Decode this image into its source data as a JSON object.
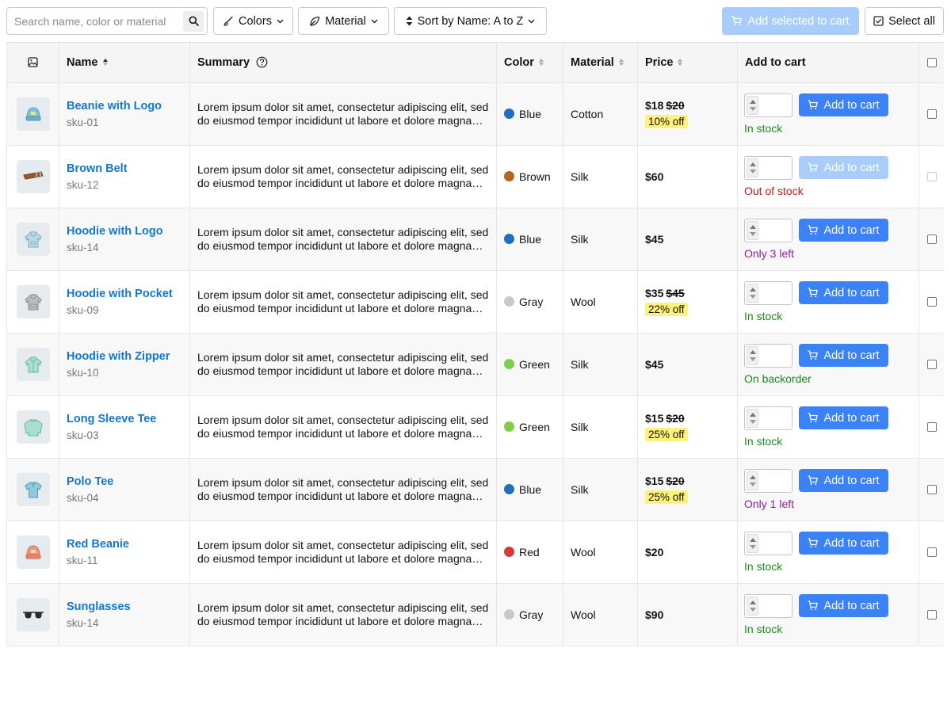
{
  "toolbar": {
    "search_placeholder": "Search name, color or material",
    "colors_label": "Colors",
    "material_label": "Material",
    "sort_label": "Sort by Name: A to Z",
    "add_selected_label": "Add selected to cart",
    "select_all_label": "Select all"
  },
  "table": {
    "headers": {
      "name": "Name",
      "summary": "Summary",
      "color": "Color",
      "material": "Material",
      "price": "Price",
      "add_to_cart": "Add to cart"
    },
    "cart_button_label": "Add to cart",
    "rows": [
      {
        "name": "Beanie with Logo",
        "sku": "sku-01",
        "summary": "Lorem ipsum dolor sit amet, consectetur adipiscing elit, sed do eiusmod tempor incididunt ut labore et dolore magna aliqua.",
        "color": "Blue",
        "color_hex": "#1f6fc1",
        "material": "Cotton",
        "price": "$18",
        "old_price": "$20",
        "discount": "10% off",
        "stock": "In stock",
        "stock_type": "in",
        "disabled": false,
        "icon": "beanie-icon"
      },
      {
        "name": "Brown Belt",
        "sku": "sku-12",
        "summary": "Lorem ipsum dolor sit amet, consectetur adipiscing elit, sed do eiusmod tempor incididunt ut labore et dolore magna aliqua.",
        "color": "Brown",
        "color_hex": "#b5651d",
        "material": "Silk",
        "price": "$60",
        "old_price": "",
        "discount": "",
        "stock": "Out of stock",
        "stock_type": "out",
        "disabled": true,
        "icon": "belt-icon"
      },
      {
        "name": "Hoodie with Logo",
        "sku": "sku-14",
        "summary": "Lorem ipsum dolor sit amet, consectetur adipiscing elit, sed do eiusmod tempor incididunt ut labore et dolore magna aliqua.",
        "color": "Blue",
        "color_hex": "#1f6fc1",
        "material": "Silk",
        "price": "$45",
        "old_price": "",
        "discount": "",
        "stock": "Only 3 left",
        "stock_type": "low",
        "disabled": false,
        "icon": "hoodie-icon"
      },
      {
        "name": "Hoodie with Pocket",
        "sku": "sku-09",
        "summary": "Lorem ipsum dolor sit amet, consectetur adipiscing elit, sed do eiusmod tempor incididunt ut labore et dolore magna aliqua.",
        "color": "Gray",
        "color_hex": "#c9c9c9",
        "material": "Wool",
        "price": "$35",
        "old_price": "$45",
        "discount": "22% off",
        "stock": "In stock",
        "stock_type": "in",
        "disabled": false,
        "icon": "hoodie-icon"
      },
      {
        "name": "Hoodie with Zipper",
        "sku": "sku-10",
        "summary": "Lorem ipsum dolor sit amet, consectetur adipiscing elit, sed do eiusmod tempor incididunt ut labore et dolore magna aliqua.",
        "color": "Green",
        "color_hex": "#7ed04a",
        "material": "Silk",
        "price": "$45",
        "old_price": "",
        "discount": "",
        "stock": "On backorder",
        "stock_type": "back",
        "disabled": false,
        "icon": "hoodie-icon"
      },
      {
        "name": "Long Sleeve Tee",
        "sku": "sku-03",
        "summary": "Lorem ipsum dolor sit amet, consectetur adipiscing elit, sed do eiusmod tempor incididunt ut labore et dolore magna aliqua.",
        "color": "Green",
        "color_hex": "#7ed04a",
        "material": "Silk",
        "price": "$15",
        "old_price": "$20",
        "discount": "25% off",
        "stock": "In stock",
        "stock_type": "in",
        "disabled": false,
        "icon": "long-sleeve-tee-icon"
      },
      {
        "name": "Polo Tee",
        "sku": "sku-04",
        "summary": "Lorem ipsum dolor sit amet, consectetur adipiscing elit, sed do eiusmod tempor incididunt ut labore et dolore magna aliqua.",
        "color": "Blue",
        "color_hex": "#1f6fc1",
        "material": "Silk",
        "price": "$15",
        "old_price": "$20",
        "discount": "25% off",
        "stock": "Only 1 left",
        "stock_type": "low",
        "disabled": false,
        "icon": "polo-tee-icon"
      },
      {
        "name": "Red Beanie",
        "sku": "sku-11",
        "summary": "Lorem ipsum dolor sit amet, consectetur adipiscing elit, sed do eiusmod tempor incididunt ut labore et dolore magna aliqua.",
        "color": "Red",
        "color_hex": "#d63b36",
        "material": "Wool",
        "price": "$20",
        "old_price": "",
        "discount": "",
        "stock": "In stock",
        "stock_type": "in",
        "disabled": false,
        "icon": "beanie-icon"
      },
      {
        "name": "Sunglasses",
        "sku": "sku-14",
        "summary": "Lorem ipsum dolor sit amet, consectetur adipiscing elit, sed do eiusmod tempor incididunt ut labore et dolore magna aliqua.",
        "color": "Gray",
        "color_hex": "#c9c9c9",
        "material": "Wool",
        "price": "$90",
        "old_price": "",
        "discount": "",
        "stock": "In stock",
        "stock_type": "in",
        "disabled": false,
        "icon": "sunglasses-icon"
      }
    ]
  }
}
